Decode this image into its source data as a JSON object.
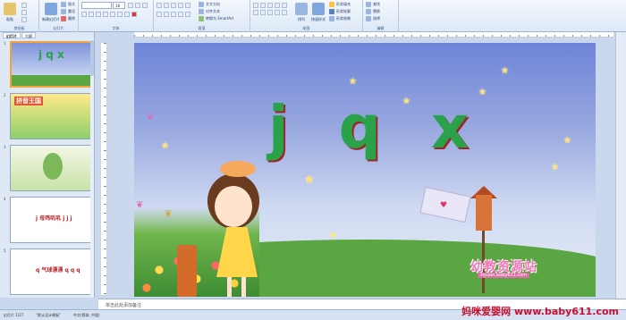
{
  "ribbon": {
    "groups": [
      {
        "label": "剪贴板"
      },
      {
        "label": "幻灯片"
      },
      {
        "label": "字体"
      },
      {
        "label": "段落"
      },
      {
        "label": "绘图"
      },
      {
        "label": "编辑"
      }
    ],
    "buttons": {
      "paste": "粘贴",
      "new_slide": "新建幻灯片",
      "layout": "版式",
      "reset": "重设",
      "delete": "删除",
      "text_direction": "文字方向",
      "align_text": "对齐文本",
      "smartart": "转换为 SmartArt",
      "arrange": "排列",
      "quick_styles": "快速样式",
      "shape_fill": "形状填充",
      "shape_outline": "形状轮廓",
      "shape_effects": "形状效果",
      "find": "查找",
      "replace": "替换",
      "select": "选择"
    },
    "font_size": "18"
  },
  "left_panel": {
    "tabs": [
      "幻灯片",
      "大纲"
    ],
    "slides": [
      {
        "num": "1",
        "title": "j q x"
      },
      {
        "num": "2",
        "title": "拼音王国"
      },
      {
        "num": "3",
        "title": ""
      },
      {
        "num": "4",
        "title": "j 母鸡叽叽 j j j"
      },
      {
        "num": "5",
        "title": "q 气球漂漂 q q q"
      }
    ]
  },
  "slide": {
    "letters": [
      "j",
      "q",
      "x"
    ],
    "logo_text": "幼教资源站",
    "logo_url": "ziyuan.baby611.com"
  },
  "notes": {
    "placeholder": "单击此处添加备注"
  },
  "status": {
    "slide_info": "幻灯片 1/27",
    "theme": "\"默认设计模板\"",
    "language": "中文(简体, 中国)"
  },
  "watermark": "妈咪爱婴网 www.baby611.com"
}
